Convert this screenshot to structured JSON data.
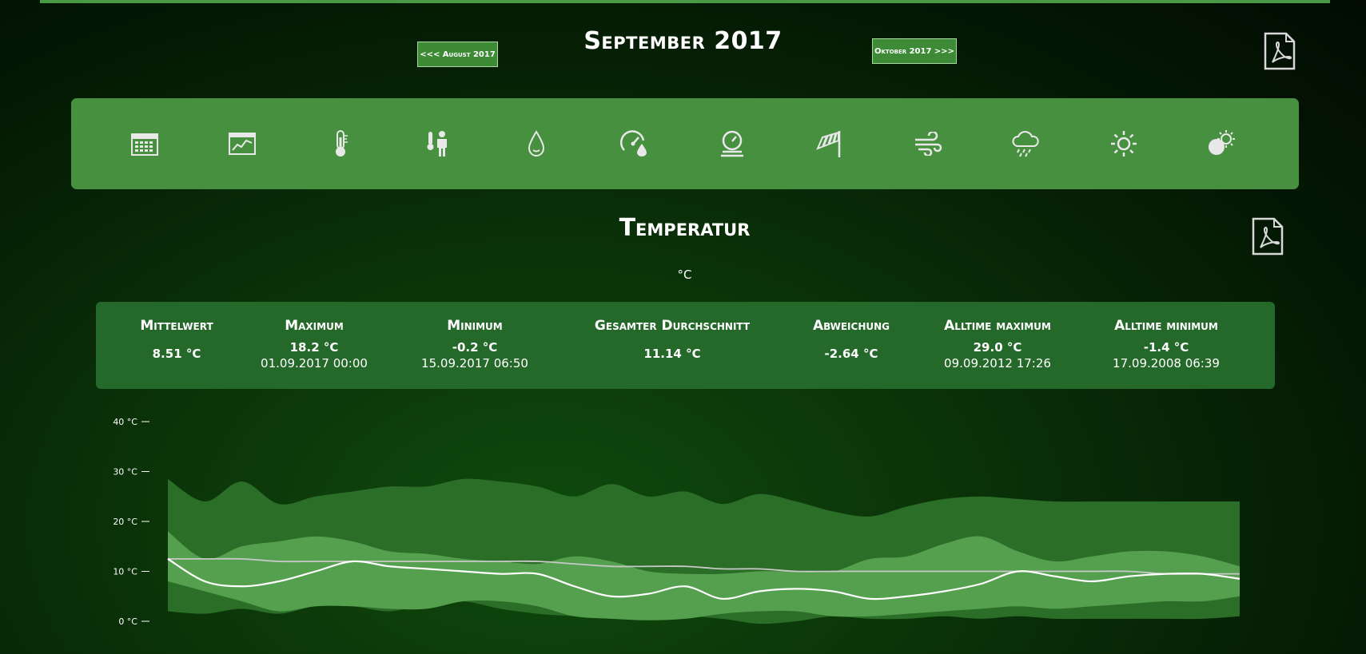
{
  "header": {
    "title": "September 2017",
    "prev_label": "<<< August 2017",
    "next_label": "Oktober 2017 >>>"
  },
  "toolbar": {
    "icons": [
      "calendar-icon",
      "chart-icon",
      "thermometer-icon",
      "apparent-temperature-icon",
      "humidity-icon",
      "dewpoint-icon",
      "pressure-icon",
      "windsock-icon",
      "wind-icon",
      "rain-icon",
      "sun-icon",
      "solar-icon"
    ]
  },
  "section": {
    "title": "Temperatur",
    "unit": "°C"
  },
  "stats": [
    {
      "label": "Mittelwert",
      "value": "8.51 °C",
      "sub": ""
    },
    {
      "label": "Maximum",
      "value": "18.2 °C",
      "sub": "01.09.2017 00:00"
    },
    {
      "label": "Minimum",
      "value": "-0.2 °C",
      "sub": "15.09.2017 06:50"
    },
    {
      "label": "Gesamter Durchschnitt",
      "value": "11.14 °C",
      "sub": ""
    },
    {
      "label": "Abweichung",
      "value": "-2.64 °C",
      "sub": ""
    },
    {
      "label": "Alltime maximum",
      "value": "29.0 °C",
      "sub": "09.09.2012 17:26"
    },
    {
      "label": "Alltime minimum",
      "value": "-1.4 °C",
      "sub": "17.09.2008 06:39"
    }
  ],
  "colors": {
    "accent": "#47903f",
    "stats_bg": "#25692a",
    "band_outer": "#2b6e28",
    "band_inner": "#55a04f",
    "line_mean": "#ffffff",
    "line_longterm": "#c8c8c8"
  },
  "chart_data": {
    "type": "area",
    "x": [
      1,
      2,
      3,
      4,
      5,
      6,
      7,
      8,
      9,
      10,
      11,
      12,
      13,
      14,
      15,
      16,
      17,
      18,
      19,
      20,
      21,
      22,
      23,
      24,
      25,
      26,
      27,
      28,
      29,
      30
    ],
    "ylim": [
      0,
      40
    ],
    "yticks": [
      "0 °C",
      "10 °C",
      "20 °C",
      "30 °C",
      "40 °C"
    ],
    "series": [
      {
        "values_max_alltime": [
          28.5,
          24,
          28,
          23.5,
          25,
          26,
          27,
          27,
          28.5,
          28,
          27,
          25,
          27.5,
          25,
          26,
          23.5,
          25.5,
          24,
          22,
          21,
          23,
          24.5,
          25,
          24.5,
          24,
          24,
          24,
          24,
          24,
          24
        ]
      },
      {
        "values_min_alltime": [
          2,
          1.5,
          2.5,
          1.5,
          3,
          3,
          2,
          3.5,
          4,
          2.5,
          1.5,
          1,
          0.5,
          0.5,
          1,
          0.5,
          -0.5,
          0,
          1,
          0.5,
          0.5,
          1,
          0.5,
          1,
          0.5,
          0.5,
          0.5,
          0.5,
          0.5,
          1
        ]
      },
      {
        "values_max": [
          18,
          12.5,
          15,
          16,
          17,
          16,
          14,
          13.5,
          12.5,
          12,
          11.5,
          13,
          12,
          10,
          9.5,
          9.5,
          10,
          10,
          10,
          12.5,
          13,
          15.5,
          17,
          14,
          12,
          13,
          14,
          14,
          13,
          11
        ]
      },
      {
        "values_min": [
          8,
          6,
          4,
          2,
          3,
          3,
          2.5,
          2.5,
          4,
          4,
          3,
          1,
          0.5,
          0.2,
          0.5,
          1.5,
          2,
          2,
          1,
          1,
          1.5,
          2,
          2.5,
          3,
          2.5,
          3,
          3.5,
          4,
          4,
          5
        ]
      },
      {
        "values_mean": [
          12.5,
          8,
          7,
          8,
          10,
          12,
          11,
          10.5,
          10,
          9.5,
          9.5,
          7,
          5,
          5.5,
          7,
          4.5,
          6,
          6.5,
          6,
          4.5,
          5,
          6,
          7.5,
          10,
          9,
          8,
          9,
          9.5,
          9.5,
          8.5
        ]
      },
      {
        "values_longterm": [
          12.5,
          12.5,
          12.5,
          12,
          12,
          12,
          12,
          12,
          12,
          12,
          12,
          11.5,
          11,
          11,
          11,
          10.5,
          10.5,
          10,
          10,
          10,
          10,
          10,
          10,
          10,
          10,
          10,
          10,
          9.5,
          9.5,
          9.5
        ]
      }
    ]
  }
}
